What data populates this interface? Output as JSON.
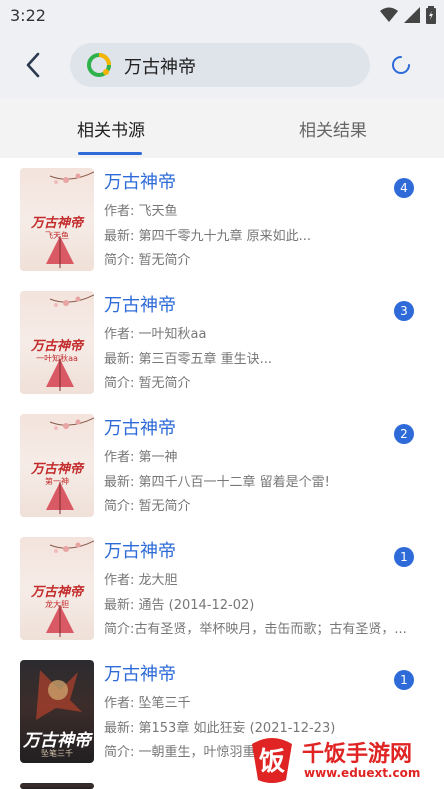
{
  "status_bar": {
    "time": "3:22",
    "icons": [
      "wifi-icon",
      "signal-icon",
      "battery-icon"
    ]
  },
  "app_bar": {
    "back_icon": "chevron-left-icon",
    "search_value": "万古神帝",
    "search_logo_icon": "search-engine-logo-icon",
    "refresh_icon": "refresh-spinner-icon"
  },
  "tabs": [
    {
      "label": "相关书源",
      "selected": true
    },
    {
      "label": "相关结果",
      "selected": false
    }
  ],
  "colors": {
    "accent": "#2e6bd8",
    "text_secondary": "#777777",
    "tab_bg": "#f3f3f3",
    "appbar_bg": "#eef0f4"
  },
  "books": [
    {
      "title": "万古神帝",
      "author": "作者: 飞天鱼",
      "latest": "最新: 第四千零九十九章 原来如此...",
      "intro": "简介: 暂无简介",
      "count": "4",
      "cover_title": "万古神帝",
      "cover_author": "飞天鱼",
      "cover_style": "light"
    },
    {
      "title": "万古神帝",
      "author": "作者: 一叶知秋aa",
      "latest": "最新: 第三百零五章 重生诀...",
      "intro": "简介: 暂无简介",
      "count": "3",
      "cover_title": "万古神帝",
      "cover_author": "一叶知秋aa",
      "cover_style": "light"
    },
    {
      "title": "万古神帝",
      "author": "作者: 第一神",
      "latest": "最新: 第四千八百一十二章 留着是个雷!",
      "intro": "简介: 暂无简介",
      "count": "2",
      "cover_title": "万古神帝",
      "cover_author": "第一神",
      "cover_style": "light"
    },
    {
      "title": "万古神帝",
      "author": "作者: 龙大胆",
      "latest": "最新: 通告 (2014-12-02)",
      "intro": "简介:古有圣贤，举杯映月，击缶而歌；古有圣贤，...",
      "count": "1",
      "cover_title": "万古神帝",
      "cover_author": "龙大胆",
      "cover_style": "light"
    },
    {
      "title": "万古神帝",
      "author": "作者: 坠笔三千",
      "latest": "最新: 第153章 如此狂妄 (2021-12-23)",
      "intro": "简介: 一朝重生，叶惊羽重生",
      "count": "1",
      "cover_title": "万古神帝",
      "cover_author": "坠笔三千",
      "cover_style": "dark"
    }
  ],
  "watermark": {
    "title": "千饭手游网",
    "url": "www.eduext.com",
    "logo_icon": "site-logo-icon"
  }
}
